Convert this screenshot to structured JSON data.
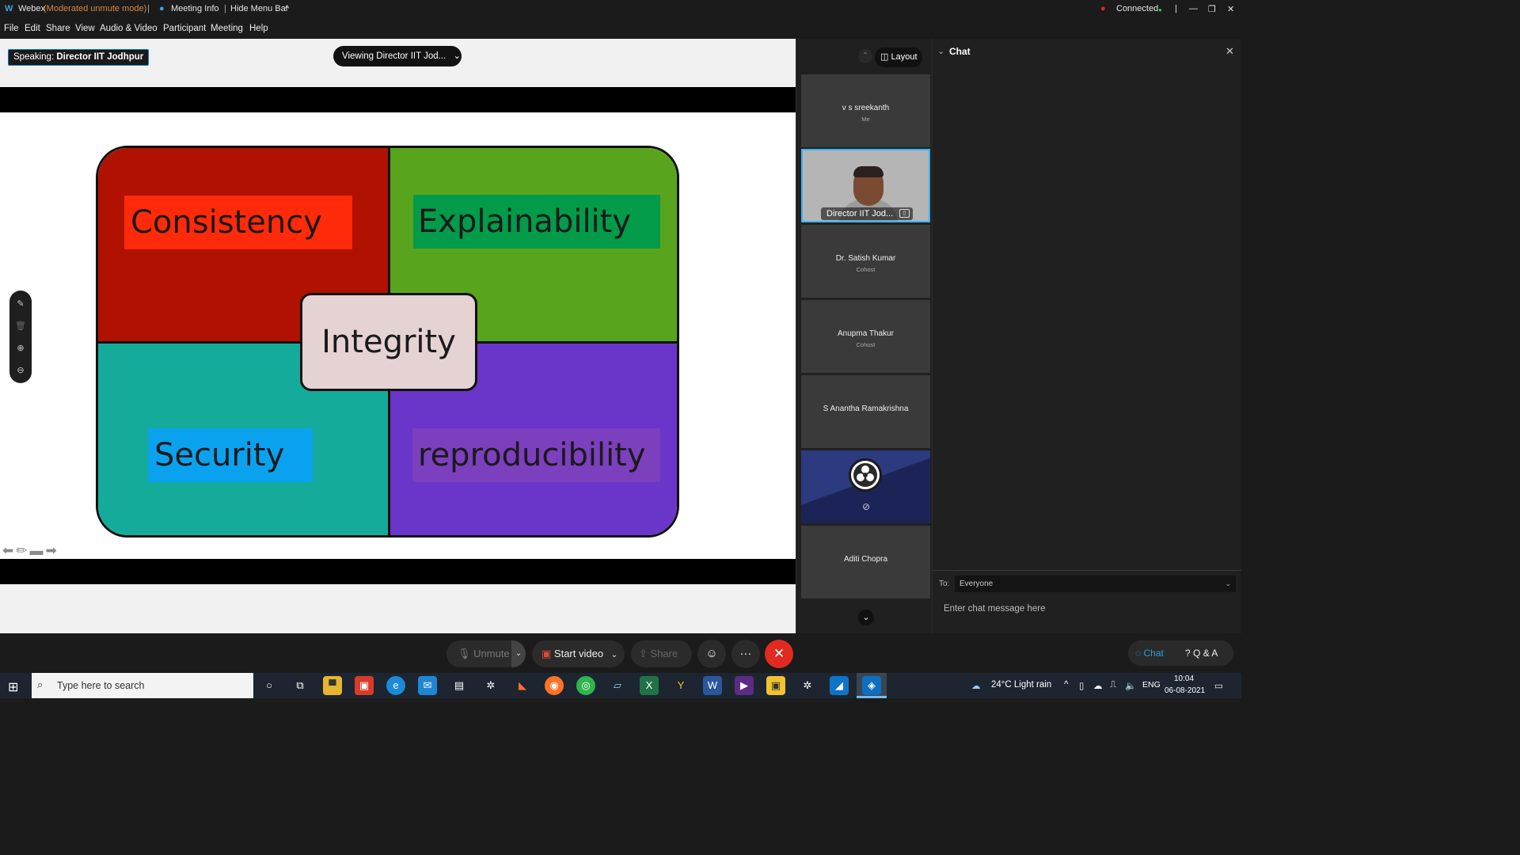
{
  "titlebar": {
    "app": "Webex",
    "mode": "(Moderated unmute mode)",
    "meeting_info": "Meeting Info",
    "hide_menu": "Hide Menu Bar",
    "connection": "Connected"
  },
  "menu": [
    "File",
    "Edit",
    "Share",
    "View",
    "Audio & Video",
    "Participant",
    "Meeting",
    "Help"
  ],
  "stage": {
    "speaking_prefix": "Speaking:",
    "speaking_name": "Director IIT Jodhpur",
    "viewing": "Viewing Director IIT Jod..."
  },
  "slide": {
    "labels": {
      "top_left": "Consistency",
      "top_right": "Explainability",
      "bottom_left": "Security",
      "bottom_right": "reproducibility",
      "center": "Integrity"
    },
    "colors": {
      "top_left": "#b01100",
      "top_right": "#59a41d",
      "bottom_left": "#14ab9b",
      "bottom_right": "#6a35c9",
      "center": "#e5d2d2"
    }
  },
  "participants_panel": {
    "layout_label": "Layout",
    "tiles": [
      {
        "name": "v s sreekanth",
        "role": "Me"
      },
      {
        "name": "Director IIT Jod...",
        "role": ""
      },
      {
        "name": "Dr. Satish Kumar",
        "role": "Cohost"
      },
      {
        "name": "Anupma Thakur",
        "role": "Cohost"
      },
      {
        "name": "S Anantha Ramakrishna",
        "role": ""
      },
      {
        "name": "",
        "role": ""
      },
      {
        "name": "Aditi Chopra",
        "role": ""
      }
    ]
  },
  "chat": {
    "title": "Chat",
    "to_label": "To:",
    "to_value": "Everyone",
    "input_placeholder": "Enter chat message here"
  },
  "controls": {
    "unmute": "Unmute",
    "start_video": "Start video",
    "share": "Share",
    "chat": "Chat",
    "qa": "Q & A"
  },
  "taskbar": {
    "search_placeholder": "Type here to search",
    "weather": "24°C  Light rain",
    "lang": "ENG",
    "time": "10:04",
    "date": "06-08-2021"
  }
}
